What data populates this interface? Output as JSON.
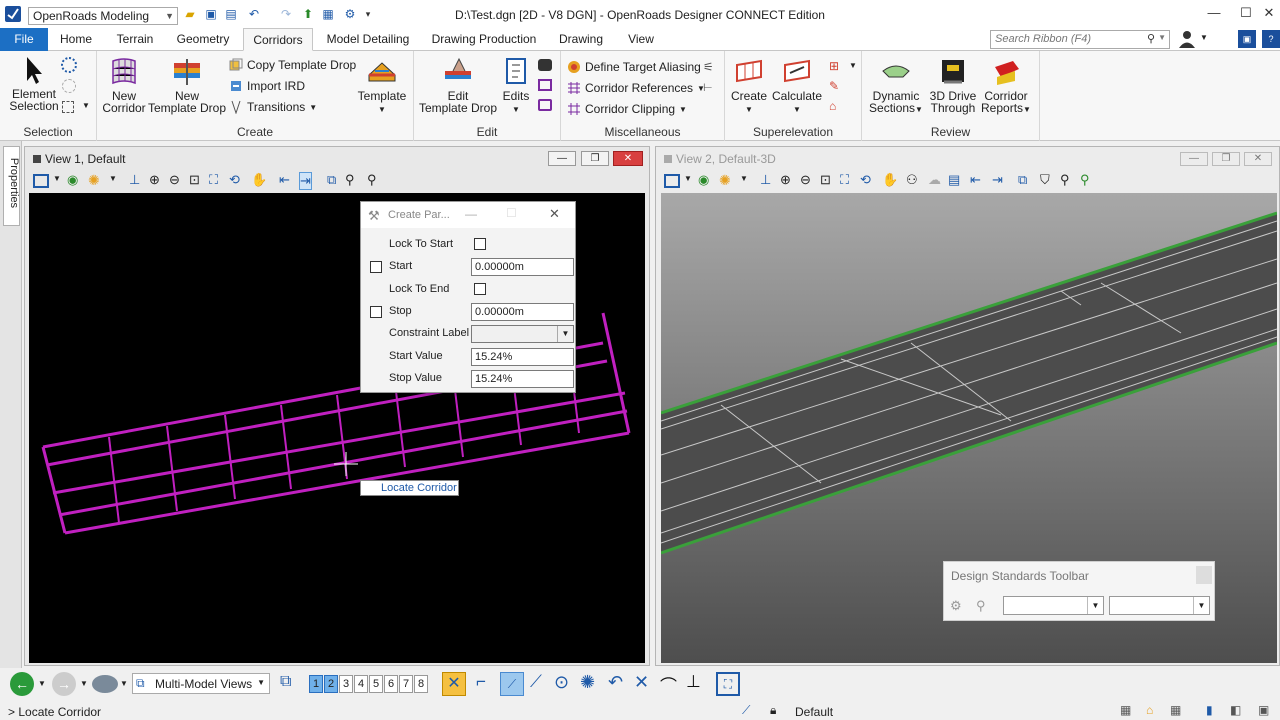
{
  "title_bar": {
    "workspace": "OpenRoads Modeling",
    "window_title": "D:\\Test.dgn [2D - V8 DGN] - OpenRoads Designer CONNECT Edition"
  },
  "tabs": [
    "File",
    "Home",
    "Terrain",
    "Geometry",
    "Corridors",
    "Model Detailing",
    "Drawing Production",
    "Drawing",
    "View"
  ],
  "active_tab": "Corridors",
  "search": {
    "placeholder": "Search Ribbon (F4)"
  },
  "ribbon": {
    "selection": {
      "label": "Selection",
      "element_selection": [
        "Element",
        "Selection"
      ]
    },
    "create": {
      "label": "Create",
      "new_corridor": [
        "New",
        "Corridor"
      ],
      "new_template_drop": [
        "New",
        "Template Drop"
      ],
      "copy_template_drop": "Copy Template Drop",
      "import_ird": "Import IRD",
      "transitions": "Transitions",
      "template": "Template"
    },
    "edit": {
      "label": "Edit",
      "edit_template_drop": [
        "Edit",
        "Template Drop"
      ],
      "edits": "Edits"
    },
    "misc": {
      "label": "Miscellaneous",
      "define_target_aliasing": "Define Target Aliasing",
      "corridor_references": "Corridor References",
      "corridor_clipping": "Corridor Clipping"
    },
    "superelevation": {
      "label": "Superelevation",
      "create": "Create",
      "calculate": "Calculate"
    },
    "review": {
      "label": "Review",
      "dynamic_sections": [
        "Dynamic",
        "Sections"
      ],
      "drive_through": [
        "3D Drive",
        "Through"
      ],
      "corridor_reports": [
        "Corridor",
        "Reports"
      ]
    }
  },
  "properties_tab": "Properties",
  "view1": {
    "title": "View 1, Default"
  },
  "view2": {
    "title": "View 2, Default-3D"
  },
  "dialog": {
    "title": "Create Par...",
    "lock_to_start": "Lock To Start",
    "start": "Start",
    "start_value": "0.00000m",
    "lock_to_end": "Lock To End",
    "stop": "Stop",
    "stop_value": "0.00000m",
    "constraint_label": "Constraint Label",
    "start_value_label": "Start Value",
    "start_value_val": "15.24%",
    "stop_value_label": "Stop Value",
    "stop_value_val": "15.24%"
  },
  "tooltip": "Locate Corridor",
  "design_standards": {
    "title": "Design Standards Toolbar"
  },
  "bottom": {
    "model_views": "Multi-Model Views",
    "view_numbers": [
      "1",
      "2",
      "3",
      "4",
      "5",
      "6",
      "7",
      "8"
    ],
    "selected_views": [
      "1",
      "2"
    ]
  },
  "status": {
    "prompt": "> Locate Corridor",
    "level": "Default"
  },
  "colors": {
    "file_tab": "#1c6fc4",
    "corridor_2d": "#c020c0",
    "canvas_2d": "#000000",
    "canvas_3d": "#5a5a5a"
  }
}
